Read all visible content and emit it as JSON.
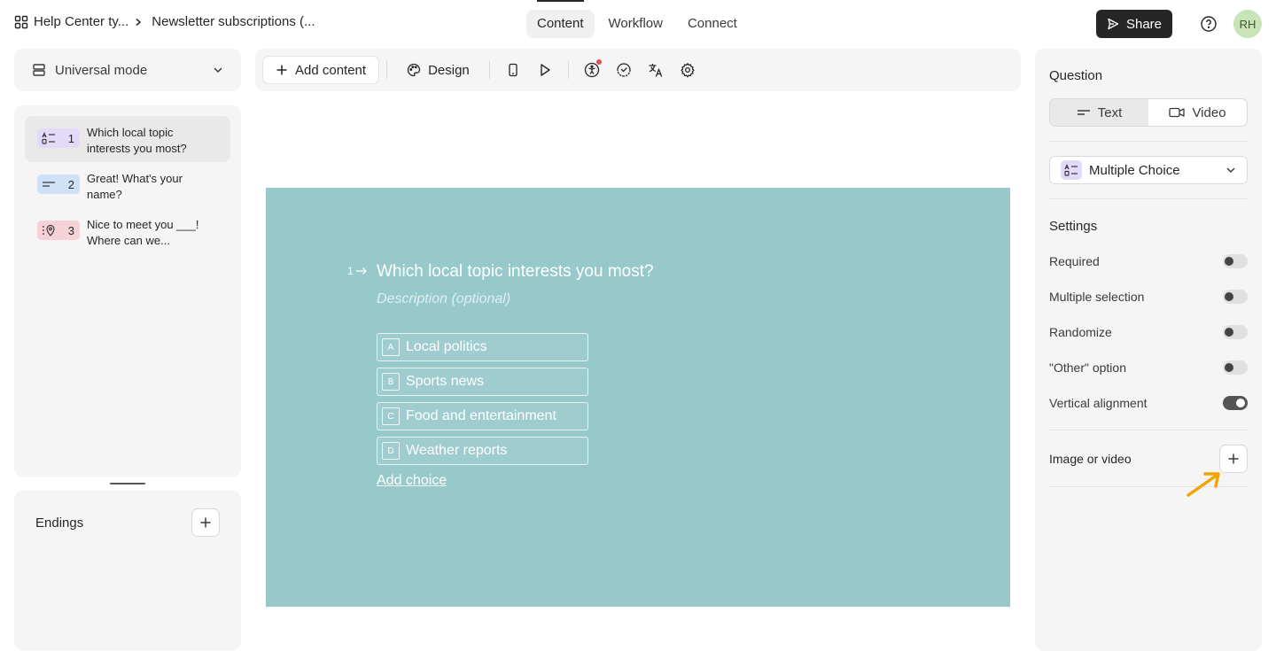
{
  "header": {
    "breadcrumbs": [
      "Help Center ty...",
      "Newsletter subscriptions (..."
    ],
    "tabs": [
      {
        "label": "Content",
        "active": true
      },
      {
        "label": "Workflow",
        "active": false
      },
      {
        "label": "Connect",
        "active": false
      }
    ],
    "share_label": "Share",
    "avatar_initials": "RH"
  },
  "mode_select": {
    "label": "Universal mode"
  },
  "questions": [
    {
      "number": "1",
      "text": "Which local topic interests you most?",
      "type_icon": "multiple-choice-icon",
      "color": "#e3daf7",
      "active": true
    },
    {
      "number": "2",
      "text": "Great! What's your name?",
      "type_icon": "short-text-icon",
      "color": "#cfe1f7",
      "active": false
    },
    {
      "number": "3",
      "text": "Nice to meet you ___! Where can we...",
      "type_icon": "address-icon",
      "color": "#f6d1d7",
      "active": false
    }
  ],
  "endings": {
    "title": "Endings"
  },
  "toolbar": {
    "add_content_label": "Add content",
    "design_label": "Design",
    "icons": [
      "mobile-preview-icon",
      "play-icon",
      "accessibility-icon",
      "loading-icon",
      "translate-icon",
      "gear-icon"
    ]
  },
  "canvas": {
    "background": "#97c9cb",
    "question_number": "1",
    "question_title": "Which local topic interests you most?",
    "description_placeholder": "Description (optional)",
    "choices": [
      {
        "key": "A",
        "label": "Local politics"
      },
      {
        "key": "B",
        "label": "Sports news"
      },
      {
        "key": "C",
        "label": "Food and entertainment"
      },
      {
        "key": "D",
        "label": "Weather reports"
      }
    ],
    "add_choice_label": "Add choice"
  },
  "right_panel": {
    "question_heading": "Question",
    "format_options": [
      {
        "label": "Text",
        "active": true
      },
      {
        "label": "Video",
        "active": false
      }
    ],
    "question_type": "Multiple Choice",
    "settings_heading": "Settings",
    "settings": [
      {
        "label": "Required",
        "on": false
      },
      {
        "label": "Multiple selection",
        "on": false
      },
      {
        "label": "Randomize",
        "on": false
      },
      {
        "label": "\"Other\" option",
        "on": false
      },
      {
        "label": "Vertical alignment",
        "on": true
      }
    ],
    "media_heading": "Image or video"
  },
  "colors": {
    "accent": "#262627",
    "hint_arrow": "#f5a300"
  }
}
